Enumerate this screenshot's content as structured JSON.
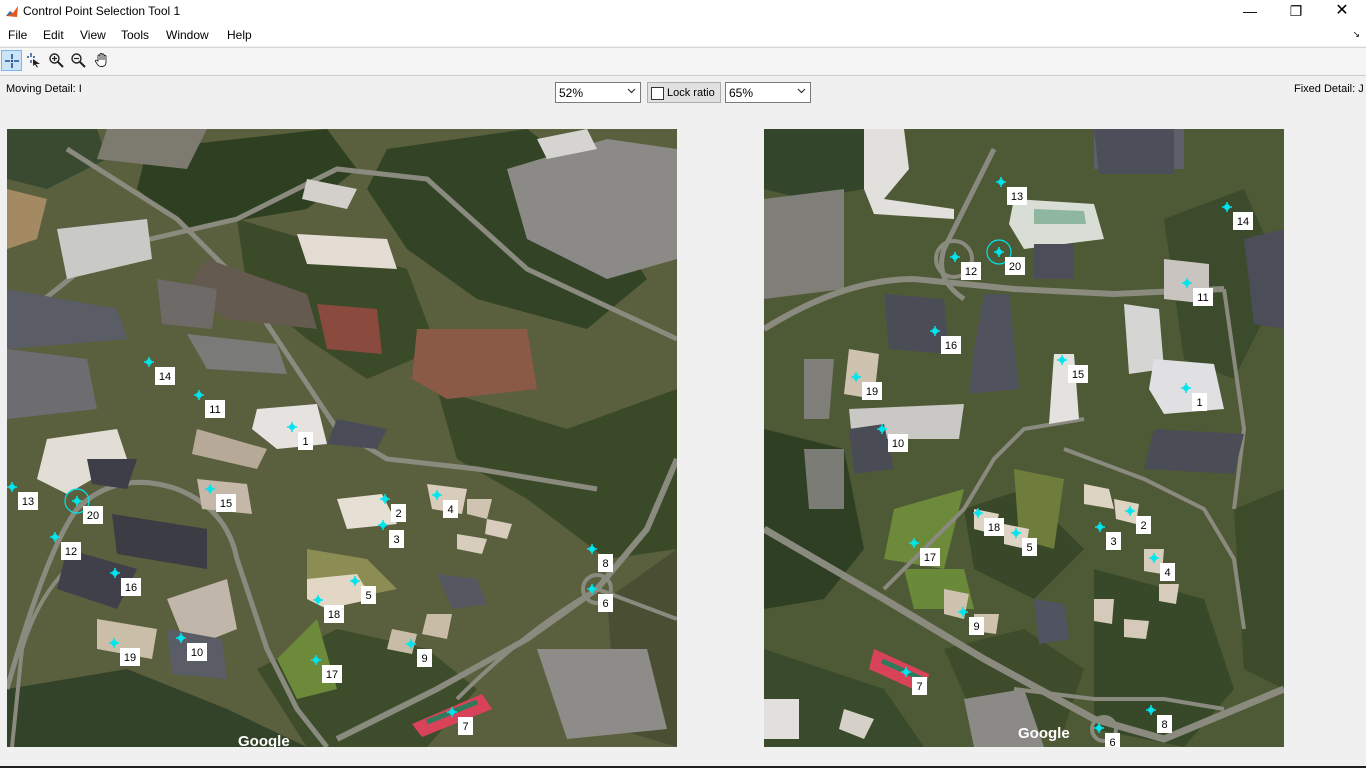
{
  "window": {
    "title": "Control Point Selection Tool 1",
    "minimize_glyph": "—",
    "maximize_glyph": "❐",
    "close_glyph": "✕"
  },
  "menu": {
    "items": [
      "File",
      "Edit",
      "View",
      "Tools",
      "Window",
      "Help"
    ],
    "overflow_glyph": "↘"
  },
  "toolbar": {
    "tools": [
      {
        "icon": "add-point-icon",
        "active": true
      },
      {
        "icon": "select-point-icon",
        "active": false
      },
      {
        "icon": "zoom-in-icon",
        "active": false
      },
      {
        "icon": "zoom-out-icon",
        "active": false
      },
      {
        "icon": "pan-hand-icon",
        "active": false
      }
    ]
  },
  "controls": {
    "moving_label": "Moving Detail: I",
    "fixed_label": "Fixed Detail: J",
    "moving_zoom": "52%",
    "fixed_zoom": "65%",
    "lock_ratio_label": "Lock ratio",
    "lock_ratio_checked": false
  },
  "moving_image": {
    "watermark": "Google",
    "points": [
      {
        "label": "1"
      },
      {
        "label": "2"
      },
      {
        "label": "3"
      },
      {
        "label": "4"
      },
      {
        "label": "5"
      },
      {
        "label": "6"
      },
      {
        "label": "7"
      },
      {
        "label": "8"
      },
      {
        "label": "9"
      },
      {
        "label": "10"
      },
      {
        "label": "11"
      },
      {
        "label": "12"
      },
      {
        "label": "13"
      },
      {
        "label": "14"
      },
      {
        "label": "15"
      },
      {
        "label": "16"
      },
      {
        "label": "17"
      },
      {
        "label": "18"
      },
      {
        "label": "19"
      },
      {
        "label": "20"
      }
    ]
  },
  "fixed_image": {
    "watermark": "Google",
    "points": [
      {
        "label": "1"
      },
      {
        "label": "2"
      },
      {
        "label": "3"
      },
      {
        "label": "4"
      },
      {
        "label": "5"
      },
      {
        "label": "6"
      },
      {
        "label": "7"
      },
      {
        "label": "8"
      },
      {
        "label": "9"
      },
      {
        "label": "10"
      },
      {
        "label": "11"
      },
      {
        "label": "12"
      },
      {
        "label": "13"
      },
      {
        "label": "14"
      },
      {
        "label": "15"
      },
      {
        "label": "16"
      },
      {
        "label": "17"
      },
      {
        "label": "18"
      },
      {
        "label": "19"
      },
      {
        "label": "20"
      }
    ]
  },
  "colors": {
    "marker": "#00e5ee",
    "active_tool_bg": "#cce4f7",
    "tennis_court": "#d9435a"
  }
}
